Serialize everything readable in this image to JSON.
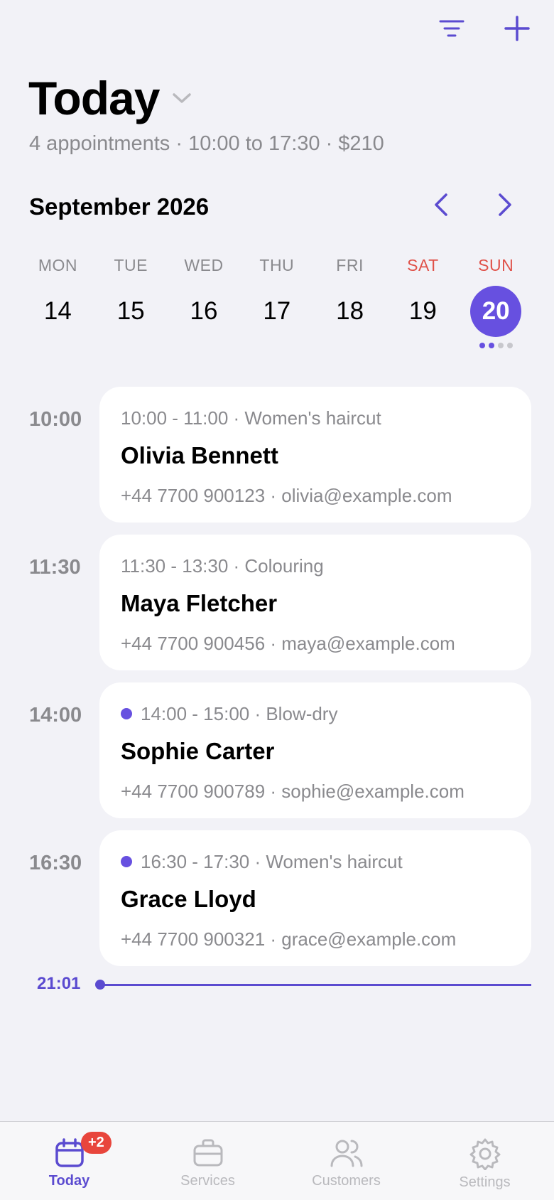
{
  "header": {
    "title": "Today",
    "summary": "4 appointments · 10:00 to 17:30 · $210"
  },
  "calendar": {
    "month": "September 2026",
    "days": [
      {
        "dow": "MON",
        "num": "14",
        "weekend": false,
        "selected": false
      },
      {
        "dow": "TUE",
        "num": "15",
        "weekend": false,
        "selected": false
      },
      {
        "dow": "WED",
        "num": "16",
        "weekend": false,
        "selected": false
      },
      {
        "dow": "THU",
        "num": "17",
        "weekend": false,
        "selected": false
      },
      {
        "dow": "FRI",
        "num": "18",
        "weekend": false,
        "selected": false
      },
      {
        "dow": "SAT",
        "num": "19",
        "weekend": true,
        "selected": false
      },
      {
        "dow": "SUN",
        "num": "20",
        "weekend": true,
        "selected": true
      }
    ]
  },
  "appointments": [
    {
      "time": "10:00",
      "meta": "10:00 - 11:00 · Women's haircut",
      "name": "Olivia Bennett",
      "contact": "+44 7700 900123 · olivia@example.com",
      "dot": false
    },
    {
      "time": "11:30",
      "meta": "11:30 - 13:30 · Colouring",
      "name": "Maya Fletcher",
      "contact": "+44 7700 900456 · maya@example.com",
      "dot": false
    },
    {
      "time": "14:00",
      "meta": "14:00 - 15:00 · Blow-dry",
      "name": "Sophie Carter",
      "contact": "+44 7700 900789 · sophie@example.com",
      "dot": true
    },
    {
      "time": "16:30",
      "meta": "16:30 - 17:30 · Women's haircut",
      "name": "Grace Lloyd",
      "contact": "+44 7700 900321 · grace@example.com",
      "dot": true
    }
  ],
  "now": {
    "time": "21:01"
  },
  "tabbar": {
    "badge": "+2",
    "tabs": [
      {
        "label": "Today",
        "icon": "calendar-icon"
      },
      {
        "label": "Services",
        "icon": "briefcase-icon"
      },
      {
        "label": "Customers",
        "icon": "people-icon"
      },
      {
        "label": "Settings",
        "icon": "gear-icon"
      }
    ]
  },
  "colors": {
    "accent": "#6750e0",
    "weekend": "#e0524a",
    "badge": "#e8453c",
    "secondary_text": "#8a8a8e"
  }
}
